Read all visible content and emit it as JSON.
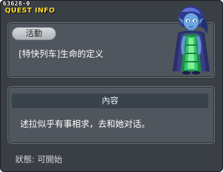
{
  "window": {
    "quest_id": "63628-0",
    "title": "QUEST INFO"
  },
  "activity": {
    "label": "活動",
    "quest_name": "[特快列车]生命的定义"
  },
  "npc": {
    "icon": "npc-portrait-icon"
  },
  "content": {
    "header": "內容",
    "text": "述拉似乎有事相求，去和她对话。"
  },
  "status": {
    "text": "狀態:  可開始"
  },
  "colors": {
    "background": "#3a3f45",
    "panel": "#50565d",
    "title": "#ffd92a",
    "header_bar": "#39434c"
  }
}
